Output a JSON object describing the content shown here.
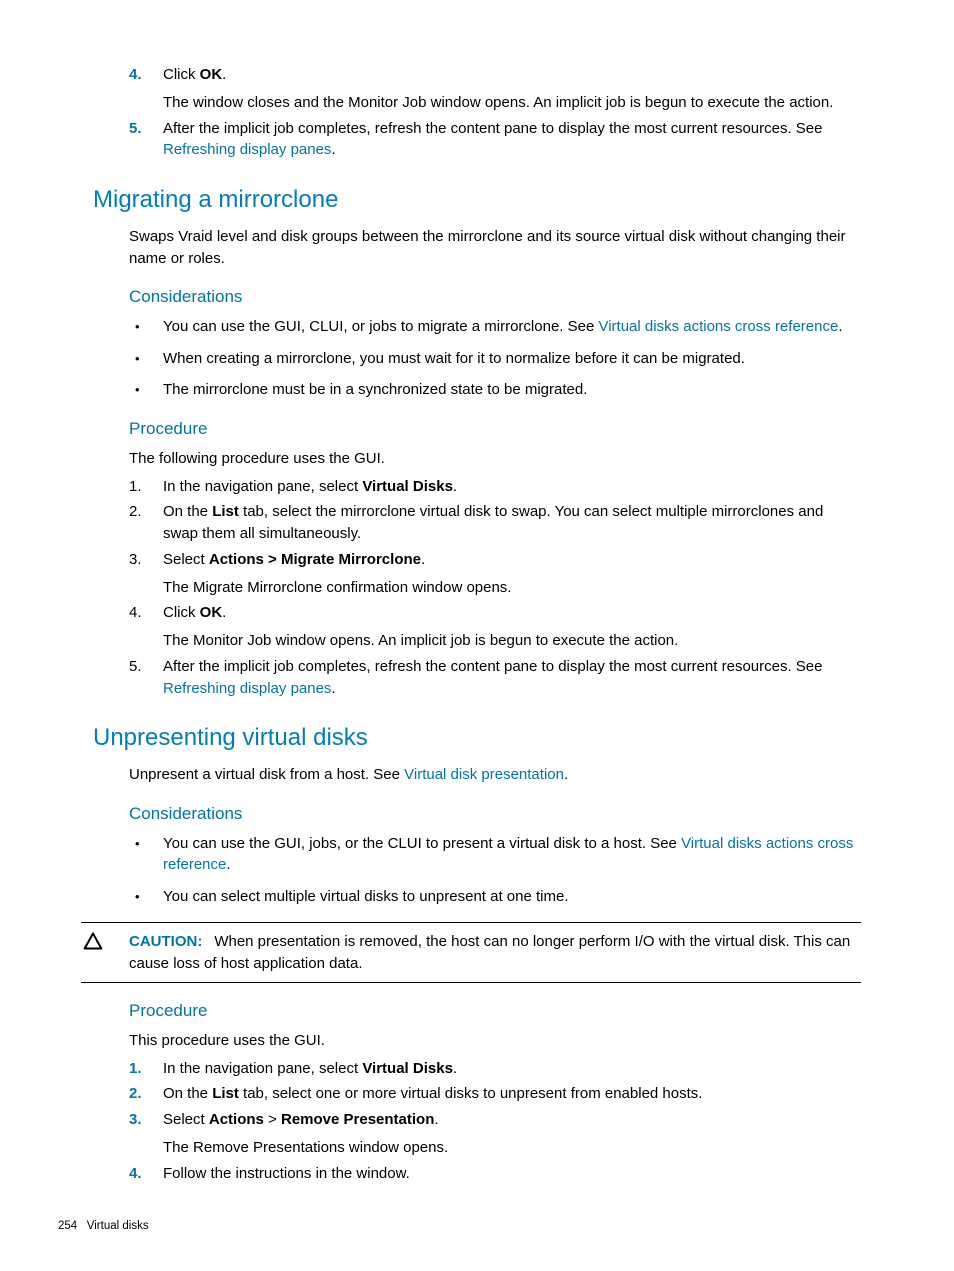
{
  "topSteps": {
    "s4": {
      "num": "4.",
      "text_pre": "Click ",
      "bold1": "OK",
      "text_post": ".",
      "sub": "The window closes and the Monitor Job window opens. An implicit job is begun to execute the action."
    },
    "s5": {
      "num": "5.",
      "text": "After the implicit job completes, refresh the content pane to display the most current resources. See ",
      "link": "Refreshing display panes",
      "text_post": "."
    }
  },
  "migrating": {
    "title": "Migrating a mirrorclone",
    "intro": "Swaps Vraid level and disk groups between the mirrorclone and its source virtual disk without changing their name or roles.",
    "considerations_h": "Considerations",
    "cons": {
      "c1_pre": "You can use the GUI, CLUI, or jobs to migrate a mirrorclone. See ",
      "c1_link": "Virtual disks actions cross reference",
      "c1_post": ".",
      "c2": "When creating a mirrorclone, you must wait for it to normalize before it can be migrated.",
      "c3": "The mirrorclone must be in a synchronized state to be migrated."
    },
    "procedure_h": "Procedure",
    "proc_intro": "The following procedure uses the GUI.",
    "steps": {
      "s1": {
        "num": "1.",
        "pre": "In the navigation pane, select ",
        "b": "Virtual Disks",
        "post": "."
      },
      "s2": {
        "num": "2.",
        "pre": "On the ",
        "b": "List",
        "post": " tab, select the mirrorclone virtual disk to swap. You can select multiple mirrorclones and swap them all simultaneously."
      },
      "s3": {
        "num": "3.",
        "pre": "Select ",
        "b": "Actions > Migrate Mirrorclone",
        "post": ".",
        "sub": "The Migrate Mirrorclone confirmation window opens."
      },
      "s4": {
        "num": "4.",
        "pre": "Click ",
        "b": "OK",
        "post": ".",
        "sub": "The Monitor Job window opens. An implicit job is begun to execute the action."
      },
      "s5": {
        "num": "5.",
        "pre": "After the implicit job completes, refresh the content pane to display the most current resources. See ",
        "link": "Refreshing display panes",
        "post": "."
      }
    }
  },
  "unpresenting": {
    "title": "Unpresenting virtual disks",
    "intro_pre": "Unpresent a virtual disk from a host. See ",
    "intro_link": "Virtual disk presentation",
    "intro_post": ".",
    "considerations_h": "Considerations",
    "cons": {
      "c1_pre": "You can use the GUI, jobs, or the CLUI to present a virtual disk to a host. See ",
      "c1_link": "Virtual disks actions cross reference",
      "c1_post": ".",
      "c2": "You can select multiple virtual disks to unpresent at one time."
    },
    "caution_label": "CAUTION:",
    "caution_text": "When presentation is removed, the host can no longer perform I/O with the virtual disk. This can cause loss of host application data.",
    "procedure_h": "Procedure",
    "proc_intro": "This procedure uses the GUI.",
    "steps": {
      "s1": {
        "num": "1.",
        "pre": "In the navigation pane, select ",
        "b": "Virtual Disks",
        "post": "."
      },
      "s2": {
        "num": "2.",
        "pre": "On the ",
        "b": "List",
        "post": " tab, select one or more virtual disks to unpresent from enabled hosts."
      },
      "s3": {
        "num": "3.",
        "pre": "Select ",
        "b1": "Actions",
        "mid": " > ",
        "b2": "Remove Presentation",
        "post": ".",
        "sub": "The Remove Presentations window opens."
      },
      "s4": {
        "num": "4.",
        "text": "Follow the instructions in the window."
      }
    }
  },
  "footer": {
    "page": "254",
    "section": "Virtual disks"
  }
}
